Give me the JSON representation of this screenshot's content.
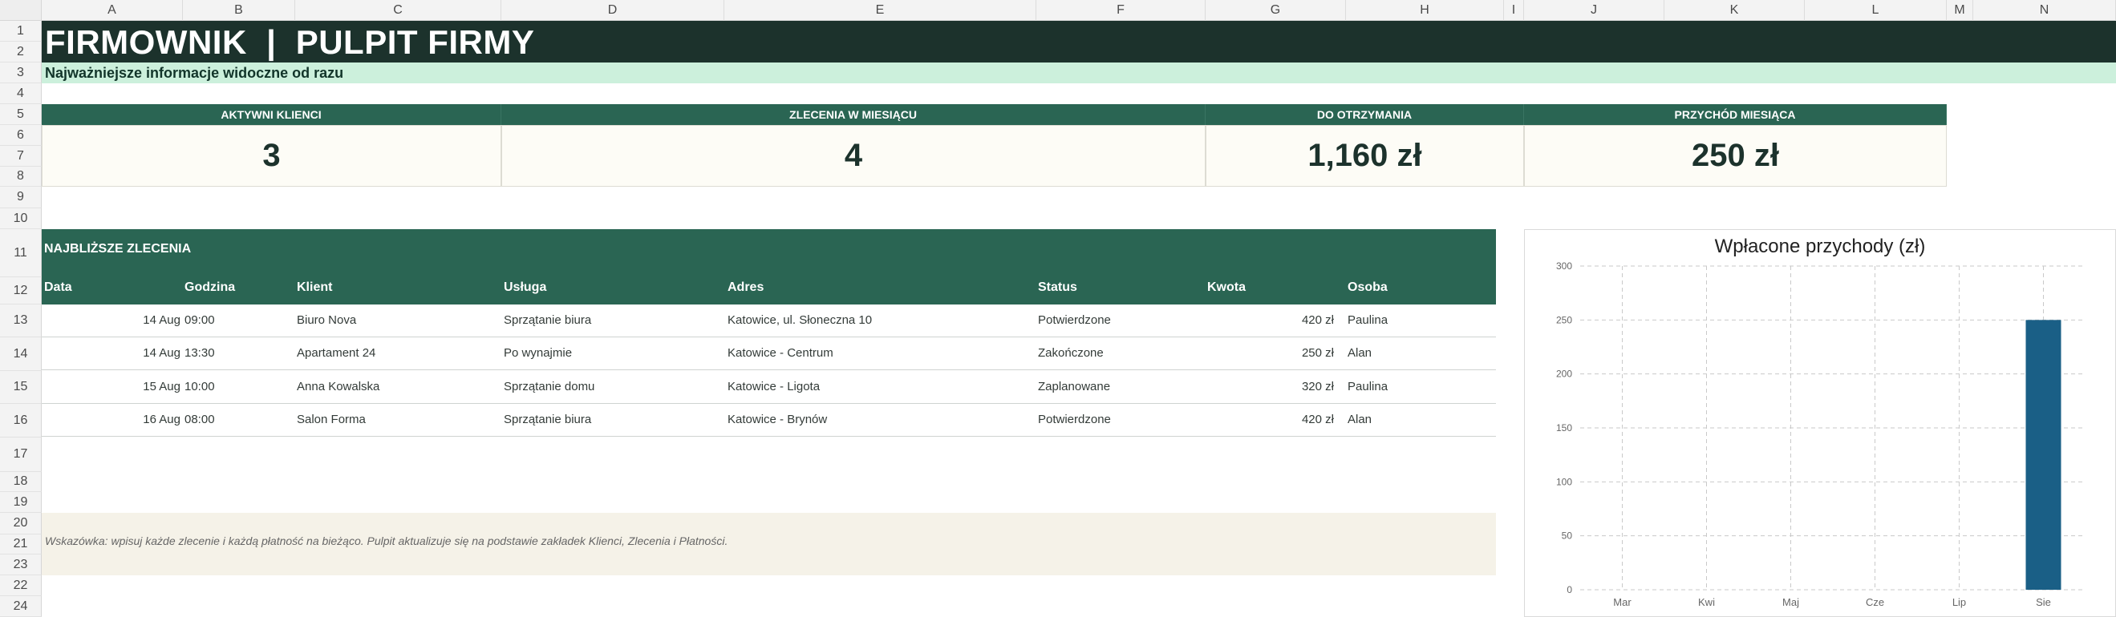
{
  "sheet": {
    "columns": [
      "A",
      "B",
      "C",
      "D",
      "E",
      "F",
      "G",
      "H",
      "I",
      "J",
      "K",
      "L",
      "M",
      "N"
    ],
    "rows": [
      "1",
      "2",
      "3",
      "4",
      "5",
      "6",
      "7",
      "8",
      "9",
      "10",
      "11",
      "12",
      "13",
      "14",
      "15",
      "16",
      "17",
      "18",
      "19",
      "20",
      "21",
      "23",
      "22",
      "24"
    ]
  },
  "header": {
    "title": "FIRMOWNIK  |  PULPIT FIRMY",
    "subtitle": "Najważniejsze informacje widoczne od razu"
  },
  "kpis": [
    {
      "label": "AKTYWNI KLIENCI",
      "value": "3"
    },
    {
      "label": "ZLECENIA W MIESIĄCU",
      "value": "4"
    },
    {
      "label": "DO OTRZYMANIA",
      "value": "1,160 zł"
    },
    {
      "label": "PRZYCHÓD MIESIĄCA",
      "value": "250 zł"
    }
  ],
  "orders": {
    "title": "NAJBLIŻSZE ZLECENIA",
    "headers": [
      "Data",
      "Godzina",
      "Klient",
      "Usługa",
      "Adres",
      "Status",
      "Kwota",
      "Osoba"
    ],
    "rows": [
      {
        "date": "14 Aug",
        "time": "09:00",
        "client": "Biuro Nova",
        "service": "Sprzątanie biura",
        "address": "Katowice, ul. Słoneczna 10",
        "status": "Potwierdzone",
        "amount": "420 zł",
        "person": "Paulina"
      },
      {
        "date": "14 Aug",
        "time": "13:30",
        "client": "Apartament 24",
        "service": "Po wynajmie",
        "address": "Katowice - Centrum",
        "status": "Zakończone",
        "amount": "250 zł",
        "person": "Alan"
      },
      {
        "date": "15 Aug",
        "time": "10:00",
        "client": "Anna Kowalska",
        "service": "Sprzątanie domu",
        "address": "Katowice - Ligota",
        "status": "Zaplanowane",
        "amount": "320 zł",
        "person": "Paulina"
      },
      {
        "date": "16 Aug",
        "time": "08:00",
        "client": "Salon Forma",
        "service": "Sprzątanie biura",
        "address": "Katowice - Brynów",
        "status": "Potwierdzone",
        "amount": "420 zł",
        "person": "Alan"
      }
    ]
  },
  "tip": "Wskazówka: wpisuj każde zlecenie i każdą płatność na bieżąco. Pulpit aktualizuje się na podstawie zakładek Klienci, Zlecenia i Płatności.",
  "colors": {
    "title_band": "#1c322c",
    "subtitle_band": "#ccf0dc",
    "accent": "#2a6553",
    "bar": "#1a5f86"
  },
  "chart_data": {
    "type": "bar",
    "title": "Wpłacone przychody (zł)",
    "categories": [
      "Mar",
      "Kwi",
      "Maj",
      "Cze",
      "Lip",
      "Sie"
    ],
    "values": [
      0,
      0,
      0,
      0,
      0,
      250
    ],
    "ylim": [
      0,
      300
    ],
    "yticks": [
      "0",
      "50",
      "100",
      "150",
      "200",
      "250",
      "300"
    ],
    "grid": true,
    "legend": "none"
  }
}
